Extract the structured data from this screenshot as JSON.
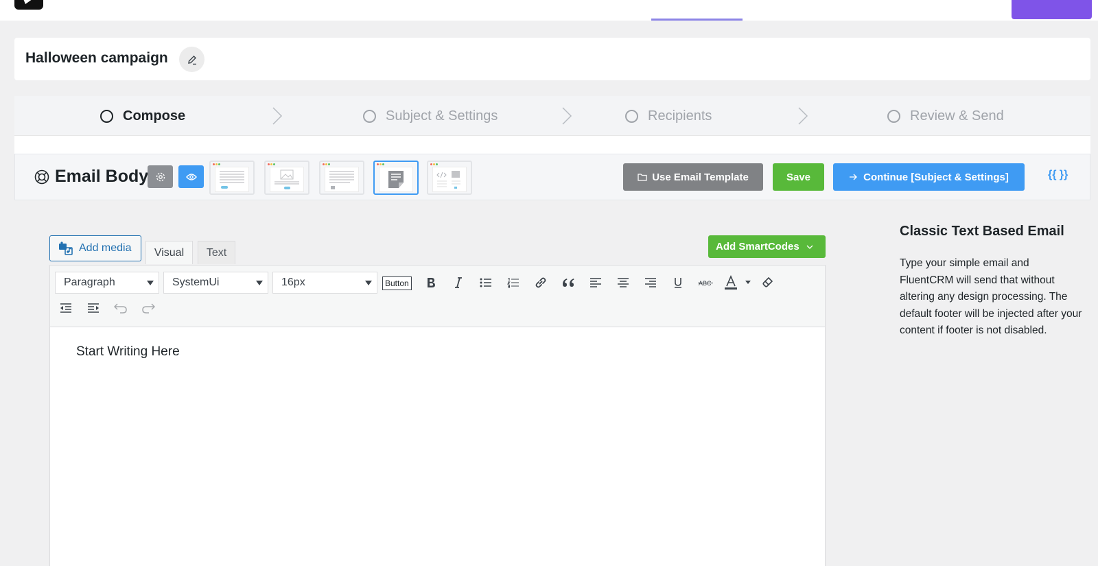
{
  "campaign": {
    "title": "Halloween campaign"
  },
  "steps": [
    {
      "label": "Compose",
      "active": true
    },
    {
      "label": "Subject & Settings",
      "active": false
    },
    {
      "label": "Recipients",
      "active": false
    },
    {
      "label": "Review & Send",
      "active": false
    }
  ],
  "email_body": {
    "title": "Email Body",
    "use_template_label": "Use Email Template",
    "save_label": "Save",
    "continue_label": "Continue [Subject & Settings]",
    "smartcode_braces": "{{ }}"
  },
  "editor": {
    "add_media_label": "Add media",
    "tab_visual": "Visual",
    "tab_text": "Text",
    "add_smartcodes_label": "Add SmartCodes",
    "format_select": "Paragraph",
    "font_select": "SystemUi",
    "size_select": "16px",
    "button_label": "Button",
    "placeholder": "Start Writing Here"
  },
  "sidebar": {
    "title": "Classic Text Based Email",
    "description": "Type your simple email and FluentCRM will send that without altering any design processing. The default footer will be injected after your content if footer is not disabled."
  },
  "colors": {
    "primary": "#3f9bf3",
    "success": "#58b93a",
    "purple": "#7f54e8",
    "grey_button": "#808285"
  }
}
